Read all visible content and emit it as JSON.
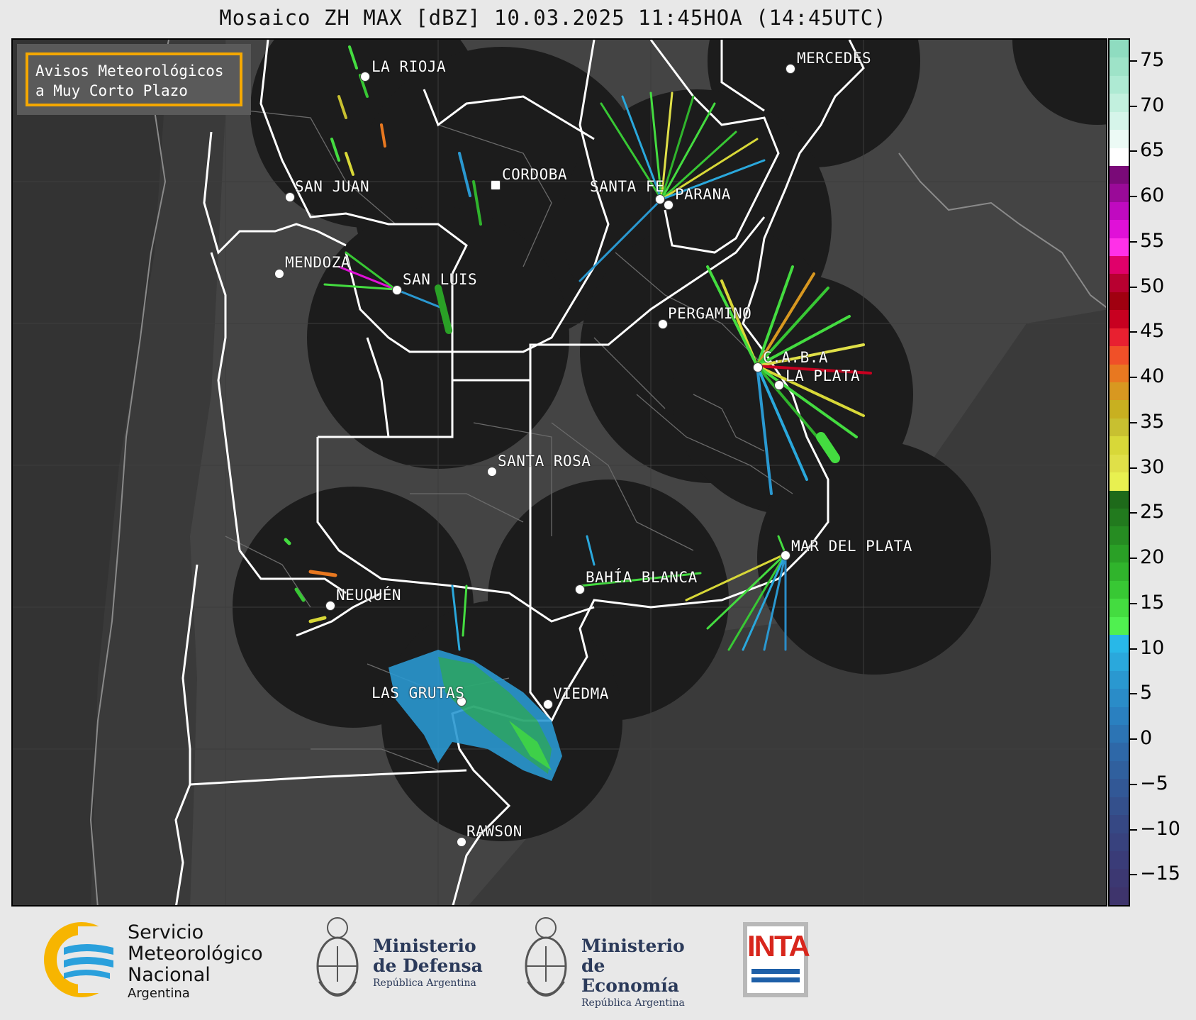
{
  "title": "Mosaico ZH MAX [dBZ] 10.03.2025 11:45HOA (14:45UTC)",
  "notice": {
    "line1": "Avisos Meteorológicos",
    "line2": "a Muy Corto Plazo"
  },
  "cities": [
    {
      "id": "la-rioja",
      "name": "LA RIOJA"
    },
    {
      "id": "mercedes",
      "name": "MERCEDES"
    },
    {
      "id": "cordoba",
      "name": "CORDOBA"
    },
    {
      "id": "san-juan",
      "name": "SAN JUAN"
    },
    {
      "id": "santa-fe",
      "name": "SANTA FE"
    },
    {
      "id": "parana",
      "name": "PARANA"
    },
    {
      "id": "mendoza",
      "name": "MENDOZA"
    },
    {
      "id": "san-luis",
      "name": "SAN LUIS"
    },
    {
      "id": "pergamino",
      "name": "PERGAMINO"
    },
    {
      "id": "caba",
      "name": "C.A.B.A"
    },
    {
      "id": "la-plata",
      "name": "LA PLATA"
    },
    {
      "id": "santa-rosa",
      "name": "SANTA ROSA"
    },
    {
      "id": "mar-del-plata",
      "name": "MAR DEL PLATA"
    },
    {
      "id": "bahia-blanca",
      "name": "BAHÍA BLANCA"
    },
    {
      "id": "neuquen",
      "name": "NEUQUÉN"
    },
    {
      "id": "las-grutas",
      "name": "LAS GRUTAS"
    },
    {
      "id": "viedma",
      "name": "VIEDMA"
    },
    {
      "id": "rawson",
      "name": "RAWSON"
    }
  ],
  "colorbar": {
    "unit": "dBZ",
    "ticks": [
      "75",
      "70",
      "65",
      "60",
      "55",
      "50",
      "45",
      "40",
      "35",
      "30",
      "25",
      "20",
      "15",
      "10",
      "5",
      "0",
      "−5",
      "−10",
      "−15"
    ],
    "colors": [
      "#8fdcc0",
      "#9ee3c8",
      "#aeead3",
      "#c2f0de",
      "#d6f5ea",
      "#ecfaf5",
      "#ffffff",
      "#7a0a78",
      "#9a0a98",
      "#c00ac0",
      "#e010d8",
      "#ff30e8",
      "#e0006a",
      "#b80030",
      "#a00010",
      "#c80020",
      "#e82030",
      "#f05028",
      "#e87820",
      "#d89820",
      "#c8b020",
      "#c8c030",
      "#d8d838",
      "#e0e048",
      "#e8f050",
      "#1e6a1a",
      "#227a1e",
      "#268c22",
      "#2aa026",
      "#30b42c",
      "#38c834",
      "#44dc40",
      "#50f050",
      "#28b8e8",
      "#2aa8dc",
      "#2a98d0",
      "#2a8cc8",
      "#2a80c0",
      "#2c74b4",
      "#2e68a8",
      "#30609e",
      "#325896",
      "#34508c",
      "#364884",
      "#38427e",
      "#3a3c78",
      "#3c3872",
      "#3e346c"
    ]
  },
  "logos": {
    "smn": {
      "line1": "Servicio",
      "line2": "Meteorológico",
      "line3": "Nacional",
      "line4": "Argentina"
    },
    "defensa": {
      "line1": "Ministerio",
      "line2": "de Defensa",
      "line3": "República Argentina"
    },
    "economia": {
      "line1": "Ministerio",
      "line2": "de Economía",
      "line3": "República Argentina"
    },
    "inta": {
      "text": "INTA"
    }
  }
}
